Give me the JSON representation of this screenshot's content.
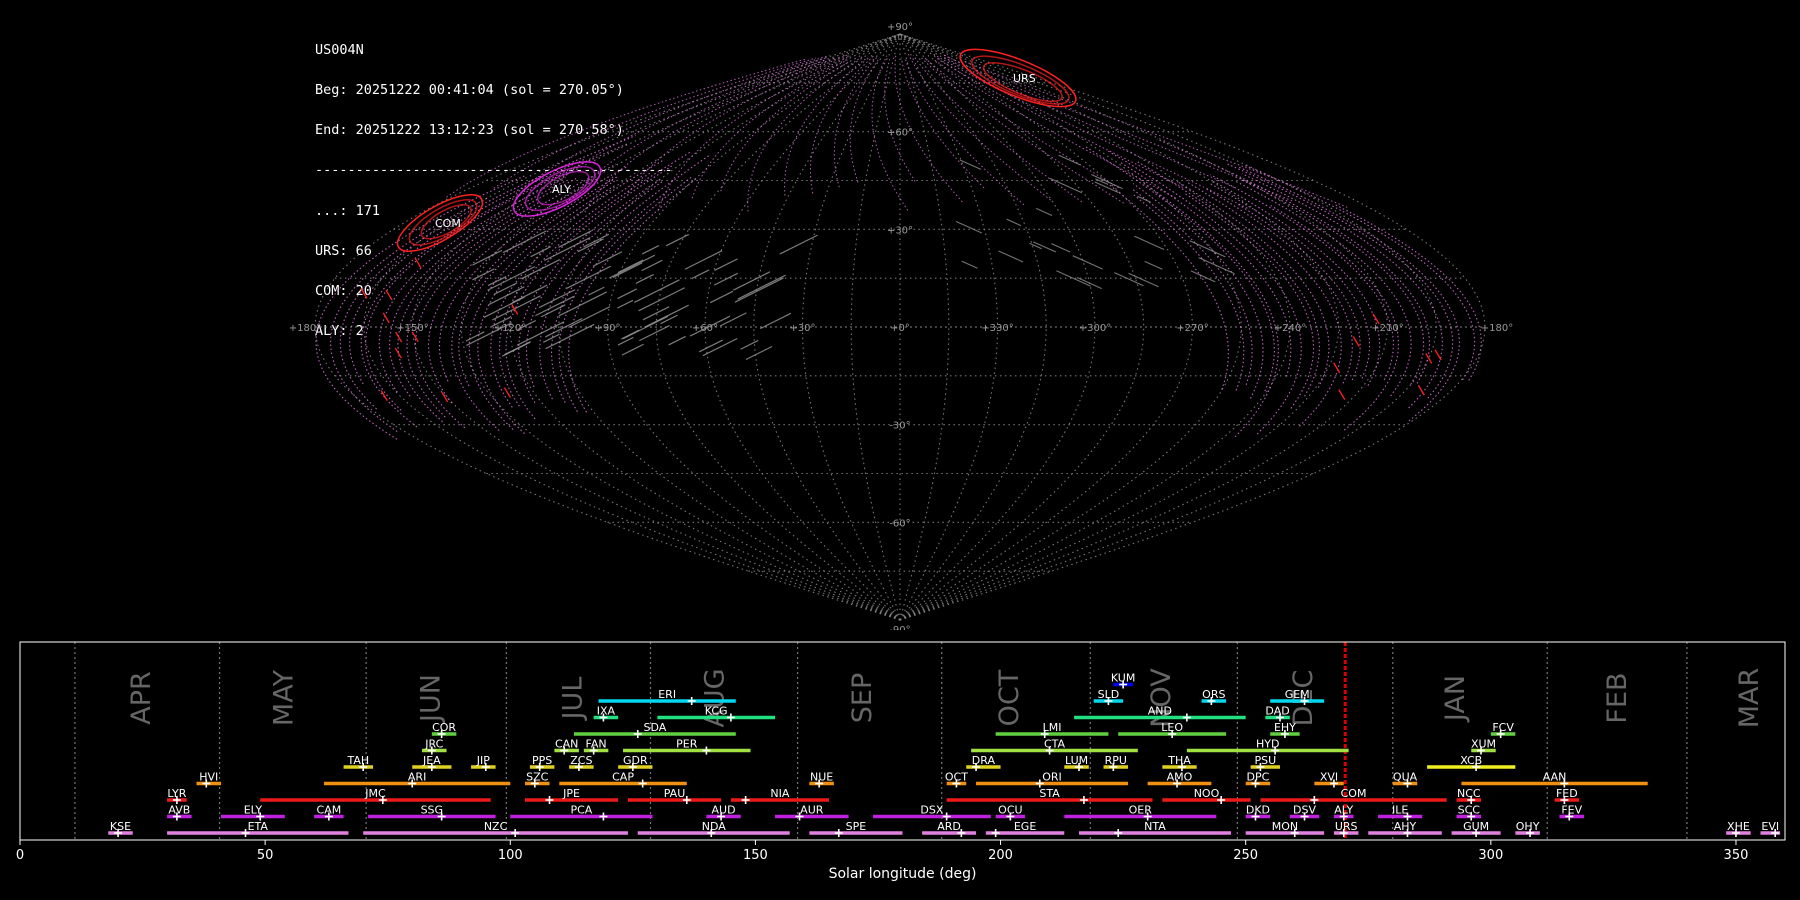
{
  "info": {
    "station": "US004N",
    "begin": "Beg: 20251222 00:41:04 (sol = 270.05°)",
    "end": "End: 20251222 13:12:23 (sol = 270.58°)",
    "separator": "--------------------------------------------",
    "counts": [
      "...: 171",
      "URS: 66",
      "COM: 20",
      "ALY: 2"
    ]
  },
  "colors": {
    "background": "#000000",
    "grid": "#8a8a8a",
    "orbit_pink": "#e87ce8",
    "orbit_red": "#ff2020",
    "orbit_gray": "#9a9a9a",
    "current_sol": "#dd0000"
  },
  "sky_map": {
    "projection": "sinusoidal",
    "lon_labels": [
      "+180°",
      "+150°",
      "+120°",
      "+90°",
      "+60°",
      "+30°",
      "+0°",
      "+330°",
      "+300°",
      "+270°",
      "+240°",
      "+210°",
      "+180°"
    ],
    "lat_labels": [
      "+90°",
      "+60°",
      "+30°",
      "-30°",
      "-60°",
      "-90°"
    ],
    "radiants": [
      {
        "code": "URS",
        "color": "#ff2020"
      },
      {
        "code": "ALY",
        "color": "#dd22dd"
      },
      {
        "code": "COM",
        "color": "#ff2020"
      }
    ]
  },
  "chart_data": {
    "type": "timeline",
    "xlabel": "Solar longitude (deg)",
    "xlim": [
      0,
      360
    ],
    "x_ticks": [
      0,
      50,
      100,
      150,
      200,
      250,
      300,
      350
    ],
    "current_sol": 270.3,
    "months": [
      {
        "name": "APR",
        "start": 11.2,
        "mid": 25
      },
      {
        "name": "MAY",
        "start": 40.7,
        "mid": 54
      },
      {
        "name": "JUN",
        "start": 70.6,
        "mid": 84
      },
      {
        "name": "JUL",
        "start": 99.2,
        "mid": 113
      },
      {
        "name": "AUG",
        "start": 128.6,
        "mid": 142
      },
      {
        "name": "SEP",
        "start": 158.6,
        "mid": 172
      },
      {
        "name": "OCT",
        "start": 188.0,
        "mid": 202
      },
      {
        "name": "NOV",
        "start": 218.3,
        "mid": 233
      },
      {
        "name": "DEC",
        "start": 248.3,
        "mid": 262
      },
      {
        "name": "JAN",
        "start": 280.0,
        "mid": 293
      },
      {
        "name": "FEB",
        "start": 311.5,
        "mid": 326
      },
      {
        "name": "MAR",
        "start": 340.0,
        "mid": 353
      }
    ],
    "showers": [
      {
        "code": "KUM",
        "start": 223,
        "end": 227,
        "peak": 225,
        "row": 9,
        "color": "#0000ff"
      },
      {
        "code": "ERI",
        "start": 118,
        "end": 146,
        "peak": 137,
        "row": 8,
        "color": "#00d8f0"
      },
      {
        "code": "SLD",
        "start": 219,
        "end": 225,
        "peak": 222,
        "row": 8,
        "color": "#00d8f0"
      },
      {
        "code": "ORS",
        "start": 241,
        "end": 246,
        "peak": 243,
        "row": 8,
        "color": "#00d8f0"
      },
      {
        "code": "GEM",
        "start": 255,
        "end": 266,
        "peak": 262,
        "row": 8,
        "color": "#00d8f0"
      },
      {
        "code": "IXA",
        "start": 117,
        "end": 122,
        "peak": 119,
        "row": 7,
        "color": "#20e080"
      },
      {
        "code": "KCG",
        "start": 130,
        "end": 154,
        "peak": 145,
        "row": 7,
        "color": "#20e080"
      },
      {
        "code": "AND",
        "start": 215,
        "end": 250,
        "peak": 238,
        "row": 7,
        "color": "#20e080"
      },
      {
        "code": "DAD",
        "start": 254,
        "end": 259,
        "peak": 257,
        "row": 7,
        "color": "#20e080"
      },
      {
        "code": "COR",
        "start": 84,
        "end": 89,
        "peak": 86,
        "row": 6,
        "color": "#60d040"
      },
      {
        "code": "SDA",
        "start": 113,
        "end": 146,
        "peak": 126,
        "row": 6,
        "color": "#60d040"
      },
      {
        "code": "LMI",
        "start": 199,
        "end": 222,
        "peak": 209,
        "row": 6,
        "color": "#60d040"
      },
      {
        "code": "LEO",
        "start": 224,
        "end": 246,
        "peak": 235,
        "row": 6,
        "color": "#60d040"
      },
      {
        "code": "EHY",
        "start": 255,
        "end": 261,
        "peak": 258,
        "row": 6,
        "color": "#60d040"
      },
      {
        "code": "FCV",
        "start": 300,
        "end": 305,
        "peak": 302,
        "row": 6,
        "color": "#60d040"
      },
      {
        "code": "JRC",
        "start": 82,
        "end": 87,
        "peak": 84,
        "row": 5,
        "color": "#a0e040"
      },
      {
        "code": "CAN",
        "start": 109,
        "end": 114,
        "peak": 111,
        "row": 5,
        "color": "#a0e040"
      },
      {
        "code": "FAN",
        "start": 115,
        "end": 120,
        "peak": 117,
        "row": 5,
        "color": "#a0e040"
      },
      {
        "code": "PER",
        "start": 123,
        "end": 149,
        "peak": 140,
        "row": 5,
        "color": "#a0e040"
      },
      {
        "code": "CTA",
        "start": 194,
        "end": 228,
        "peak": 210,
        "row": 5,
        "color": "#a0e040"
      },
      {
        "code": "HYD",
        "start": 238,
        "end": 271,
        "peak": 256,
        "row": 5,
        "color": "#a0e040"
      },
      {
        "code": "XUM",
        "start": 296,
        "end": 301,
        "peak": 298,
        "row": 5,
        "color": "#a0e040"
      },
      {
        "code": "TAH",
        "start": 66,
        "end": 72,
        "peak": 70,
        "row": 4,
        "color": "#e0d020"
      },
      {
        "code": "JEA",
        "start": 80,
        "end": 88,
        "peak": 84,
        "row": 4,
        "color": "#e0d020"
      },
      {
        "code": "JIP",
        "start": 92,
        "end": 97,
        "peak": 95,
        "row": 4,
        "color": "#e0d020"
      },
      {
        "code": "PPS",
        "start": 104,
        "end": 109,
        "peak": 106,
        "row": 4,
        "color": "#e0d020"
      },
      {
        "code": "ZCS",
        "start": 112,
        "end": 117,
        "peak": 114,
        "row": 4,
        "color": "#e0d020"
      },
      {
        "code": "GDR",
        "start": 122,
        "end": 129,
        "peak": 125,
        "row": 4,
        "color": "#e0d020"
      },
      {
        "code": "DRA",
        "start": 193,
        "end": 200,
        "peak": 195,
        "row": 4,
        "color": "#e0d020"
      },
      {
        "code": "LUM",
        "start": 213,
        "end": 218,
        "peak": 216,
        "row": 4,
        "color": "#e0d020"
      },
      {
        "code": "RPU",
        "start": 221,
        "end": 226,
        "peak": 223,
        "row": 4,
        "color": "#e0d020"
      },
      {
        "code": "THA",
        "start": 233,
        "end": 240,
        "peak": 237,
        "row": 4,
        "color": "#e0d020"
      },
      {
        "code": "PSU",
        "start": 251,
        "end": 257,
        "peak": 253,
        "row": 4,
        "color": "#e0d020"
      },
      {
        "code": "XCB",
        "start": 287,
        "end": 305,
        "peak": 297,
        "row": 4,
        "color": "#f0f020"
      },
      {
        "code": "HVI",
        "start": 36,
        "end": 41,
        "peak": 38,
        "row": 3,
        "color": "#f09010"
      },
      {
        "code": "ARI",
        "start": 62,
        "end": 100,
        "peak": 80,
        "row": 3,
        "color": "#f09010"
      },
      {
        "code": "SZC",
        "start": 103,
        "end": 108,
        "peak": 105,
        "row": 3,
        "color": "#f09010"
      },
      {
        "code": "CAP",
        "start": 110,
        "end": 136,
        "peak": 127,
        "row": 3,
        "color": "#f09010"
      },
      {
        "code": "NUE",
        "start": 161,
        "end": 166,
        "peak": 163,
        "row": 3,
        "color": "#f09010"
      },
      {
        "code": "OCT",
        "start": 189,
        "end": 193,
        "peak": 191,
        "row": 3,
        "color": "#f09010"
      },
      {
        "code": "ORI",
        "start": 195,
        "end": 226,
        "peak": 208,
        "row": 3,
        "color": "#f09010"
      },
      {
        "code": "AMO",
        "start": 230,
        "end": 243,
        "peak": 236,
        "row": 3,
        "color": "#f09010"
      },
      {
        "code": "DPC",
        "start": 250,
        "end": 255,
        "peak": 252,
        "row": 3,
        "color": "#f09010"
      },
      {
        "code": "XVI",
        "start": 264,
        "end": 270,
        "peak": 268,
        "row": 3,
        "color": "#f09010"
      },
      {
        "code": "QUA",
        "start": 280,
        "end": 285,
        "peak": 283,
        "row": 3,
        "color": "#f09010"
      },
      {
        "code": "AAN",
        "start": 294,
        "end": 332,
        "peak": 315,
        "row": 3,
        "color": "#f09010"
      },
      {
        "code": "LYR",
        "start": 30,
        "end": 34,
        "peak": 32,
        "row": 2,
        "color": "#ee1a1a"
      },
      {
        "code": "JMC",
        "start": 49,
        "end": 96,
        "peak": 74,
        "row": 2,
        "color": "#ee1a1a"
      },
      {
        "code": "JPE",
        "start": 103,
        "end": 122,
        "peak": 108,
        "row": 2,
        "color": "#ee1a1a"
      },
      {
        "code": "PAU",
        "start": 124,
        "end": 143,
        "peak": 136,
        "row": 2,
        "color": "#ee1a1a"
      },
      {
        "code": "NIA",
        "start": 145,
        "end": 165,
        "peak": 148,
        "row": 2,
        "color": "#ee1a1a"
      },
      {
        "code": "STA",
        "start": 189,
        "end": 231,
        "peak": 217,
        "row": 2,
        "color": "#ee1a1a"
      },
      {
        "code": "NOO",
        "start": 233,
        "end": 251,
        "peak": 245,
        "row": 2,
        "color": "#ee1a1a"
      },
      {
        "code": "COM",
        "start": 253,
        "end": 291,
        "peak": 264,
        "row": 2,
        "color": "#ee1a1a"
      },
      {
        "code": "NCC",
        "start": 293,
        "end": 298,
        "peak": 296,
        "row": 2,
        "color": "#ee1a1a"
      },
      {
        "code": "FED",
        "start": 313,
        "end": 318,
        "peak": 315,
        "row": 2,
        "color": "#ee1a1a"
      },
      {
        "code": "AVB",
        "start": 30,
        "end": 35,
        "peak": 32,
        "row": 1,
        "color": "#c020e0"
      },
      {
        "code": "ELY",
        "start": 41,
        "end": 54,
        "peak": 49,
        "row": 1,
        "color": "#c020e0"
      },
      {
        "code": "CAM",
        "start": 60,
        "end": 66,
        "peak": 63,
        "row": 1,
        "color": "#c020e0"
      },
      {
        "code": "SSG",
        "start": 71,
        "end": 97,
        "peak": 86,
        "row": 1,
        "color": "#c020e0"
      },
      {
        "code": "PCA",
        "start": 100,
        "end": 129,
        "peak": 119,
        "row": 1,
        "color": "#c020e0"
      },
      {
        "code": "AUD",
        "start": 140,
        "end": 147,
        "peak": 143,
        "row": 1,
        "color": "#c020e0"
      },
      {
        "code": "AUR",
        "start": 154,
        "end": 169,
        "peak": 159,
        "row": 1,
        "color": "#c020e0"
      },
      {
        "code": "DSX",
        "start": 174,
        "end": 198,
        "peak": 189,
        "row": 1,
        "color": "#c020e0"
      },
      {
        "code": "OCU",
        "start": 199,
        "end": 205,
        "peak": 202,
        "row": 1,
        "color": "#c020e0"
      },
      {
        "code": "OER",
        "start": 213,
        "end": 244,
        "peak": 230,
        "row": 1,
        "color": "#c020e0"
      },
      {
        "code": "DKD",
        "start": 250,
        "end": 255,
        "peak": 252,
        "row": 1,
        "color": "#c020e0"
      },
      {
        "code": "DSV",
        "start": 259,
        "end": 265,
        "peak": 262,
        "row": 1,
        "color": "#c020e0"
      },
      {
        "code": "ALY",
        "start": 268,
        "end": 272,
        "peak": 270,
        "row": 1,
        "color": "#c020e0"
      },
      {
        "code": "ILE",
        "start": 277,
        "end": 286,
        "peak": 283,
        "row": 1,
        "color": "#c020e0"
      },
      {
        "code": "SCC",
        "start": 293,
        "end": 298,
        "peak": 296,
        "row": 1,
        "color": "#c020e0"
      },
      {
        "code": "FEV",
        "start": 314,
        "end": 319,
        "peak": 316,
        "row": 1,
        "color": "#c020e0"
      },
      {
        "code": "KSE",
        "start": 18,
        "end": 23,
        "peak": 20,
        "row": 0,
        "color": "#e080e0"
      },
      {
        "code": "ETA",
        "start": 30,
        "end": 67,
        "peak": 46,
        "row": 0,
        "color": "#e080e0"
      },
      {
        "code": "NZC",
        "start": 70,
        "end": 124,
        "peak": 101,
        "row": 0,
        "color": "#e080e0"
      },
      {
        "code": "NDA",
        "start": 126,
        "end": 157,
        "peak": 141,
        "row": 0,
        "color": "#e080e0"
      },
      {
        "code": "SPE",
        "start": 161,
        "end": 180,
        "peak": 167,
        "row": 0,
        "color": "#e080e0"
      },
      {
        "code": "ARD",
        "start": 184,
        "end": 195,
        "peak": 192,
        "row": 0,
        "color": "#e080e0"
      },
      {
        "code": "EGE",
        "start": 197,
        "end": 213,
        "peak": 199,
        "row": 0,
        "color": "#e080e0"
      },
      {
        "code": "NTA",
        "start": 216,
        "end": 247,
        "peak": 224,
        "row": 0,
        "color": "#e080e0"
      },
      {
        "code": "MON",
        "start": 250,
        "end": 266,
        "peak": 260,
        "row": 0,
        "color": "#e080e0"
      },
      {
        "code": "URS",
        "start": 268,
        "end": 273,
        "peak": 270,
        "row": 0,
        "color": "#e080e0"
      },
      {
        "code": "AHY",
        "start": 275,
        "end": 290,
        "peak": 283,
        "row": 0,
        "color": "#e080e0"
      },
      {
        "code": "GUM",
        "start": 292,
        "end": 302,
        "peak": 297,
        "row": 0,
        "color": "#e080e0"
      },
      {
        "code": "OHY",
        "start": 305,
        "end": 310,
        "peak": 308,
        "row": 0,
        "color": "#e080e0"
      },
      {
        "code": "XHE",
        "start": 348,
        "end": 353,
        "peak": 350,
        "row": 0,
        "color": "#e080e0"
      },
      {
        "code": "EVI",
        "start": 355,
        "end": 359,
        "peak": 358,
        "row": 0,
        "color": "#e080e0"
      }
    ]
  }
}
